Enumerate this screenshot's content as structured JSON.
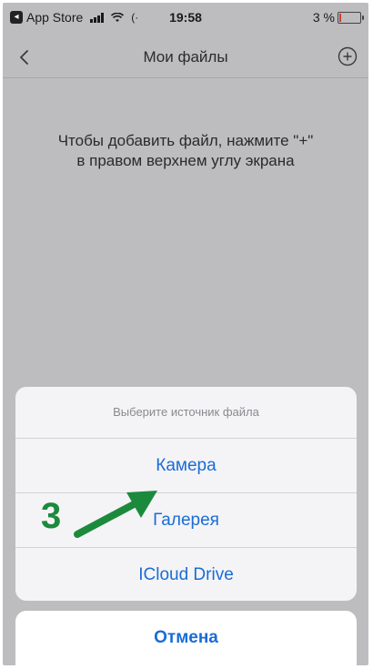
{
  "status_bar": {
    "carrier": "App Store",
    "time": "19:58",
    "battery_percent": "3 %",
    "battery_level": 0.03
  },
  "nav": {
    "title": "Мои файлы",
    "back_icon": "chevron-left-icon",
    "add_icon": "plus-circle-icon"
  },
  "empty_state": {
    "line1": "Чтобы добавить файл, нажмите \"+\"",
    "line2": "в правом верхнем углу экрана"
  },
  "action_sheet": {
    "title": "Выберите источник файла",
    "options": [
      {
        "label": "Камера"
      },
      {
        "label": "Галерея"
      },
      {
        "label": "ICloud Drive"
      }
    ],
    "cancel_label": "Отмена"
  },
  "annotation": {
    "step": "3",
    "color": "#1c8a3c"
  },
  "colors": {
    "accent": "#1a6cd6",
    "battery_low": "#d13b2e"
  }
}
